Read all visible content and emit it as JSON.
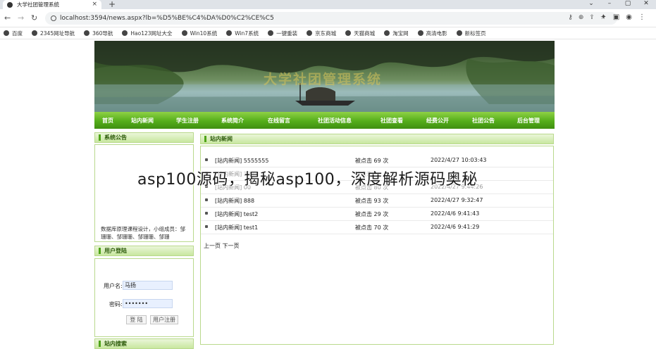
{
  "browser": {
    "tab_title": "大学社团管理系统",
    "url": "localhost:3594/news.aspx?lb=%D5%BE%C4%DA%D0%C2%CE%C5",
    "bookmarks": [
      "百度",
      "2345网址导航",
      "360导航",
      "Hao123网址大全",
      "Win10系统",
      "Win7系统",
      "一键重装",
      "京东商城",
      "天猫商城",
      "淘宝网",
      "高清电影",
      "新标签页"
    ]
  },
  "site": {
    "banner_title": "大学社团管理系统",
    "nav": [
      "首页",
      "站内新闻",
      "学生注册",
      "系统简介",
      "在线留言",
      "社团活动信息",
      "社团查看",
      "经费公开",
      "社团公告",
      "后台管理"
    ]
  },
  "sidebar": {
    "notice_title": "系统公告",
    "notice_text": "数据库原理课程设计，小组成员：邹珊珊、邹珊珊、邹珊珊、邹珊",
    "login_title": "用户登陆",
    "username_label": "用户名:",
    "username_value": "马扬",
    "password_label": "密码:",
    "password_value": "•••••••",
    "login_button": "登 陆",
    "register_button": "用户注册",
    "search_title": "站内搜索"
  },
  "news": {
    "title": "站内新闻",
    "rows": [
      {
        "title": "[站内新闻] 5555555",
        "clicks": "被点击 69 次",
        "time": "2022/4/27 10:03:43"
      },
      {
        "title": "[站内新闻] 3333",
        "clicks": "被点击 ",
        "time": ""
      },
      {
        "title": "[站内新闻] 00",
        "clicks": "被点击 80 次",
        "time": "2022/4/27 9:44:26"
      },
      {
        "title": "[站内新闻] 888",
        "clicks": "被点击 93 次",
        "time": "2022/4/27 9:32:47"
      },
      {
        "title": "[站内新闻] test2",
        "clicks": "被点击 29 次",
        "time": "2022/4/6 9:41:43"
      },
      {
        "title": "[站内新闻] test1",
        "clicks": "被点击 70 次",
        "time": "2022/4/6 9:41:29"
      }
    ],
    "pager": "上一页 下一页"
  },
  "overlay_text": "asp100源码，揭秘asp100，深度解析源码奥秘"
}
